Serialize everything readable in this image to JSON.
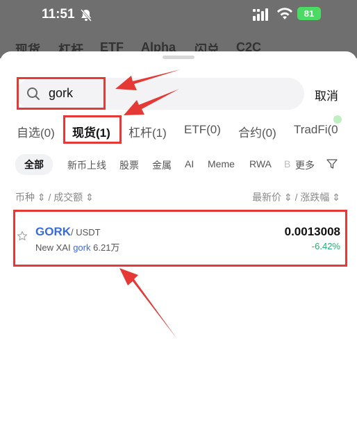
{
  "status_bar": {
    "time": "11:51",
    "battery": "81"
  },
  "background_tabs": [
    "现货",
    "杠杆",
    "ETF",
    "Alpha",
    "闪兑",
    "C2C"
  ],
  "search": {
    "query": "gork",
    "cancel_label": "取消"
  },
  "categories": [
    {
      "label": "自选(0)"
    },
    {
      "label": "现货(1)",
      "active": true
    },
    {
      "label": "杠杆(1)"
    },
    {
      "label": "ETF(0)"
    },
    {
      "label": "合约(0)"
    },
    {
      "label": "TradFi(0"
    }
  ],
  "filter_chips": [
    "全部",
    "新币上线",
    "股票",
    "金属",
    "AI",
    "Meme",
    "RWA",
    "B",
    "更多"
  ],
  "column_headers": {
    "left": "币种 ⇕ / 成交额 ⇕",
    "right": "最新价 ⇕ / 涨跌幅 ⇕"
  },
  "result": {
    "base": "GORK",
    "quote": "/ USDT",
    "name_prefix": "New XAI",
    "name_highlight": "gork",
    "volume": "6.21万",
    "price": "0.0013008",
    "change": "-6.42%"
  },
  "colors": {
    "accent": "#3a6bdc",
    "up": "#1fae6e",
    "annotation": "#e53935"
  },
  "icons": [
    "bell-slash-icon",
    "signal-icon",
    "wifi-icon",
    "search-icon",
    "filter-icon",
    "star-icon"
  ]
}
